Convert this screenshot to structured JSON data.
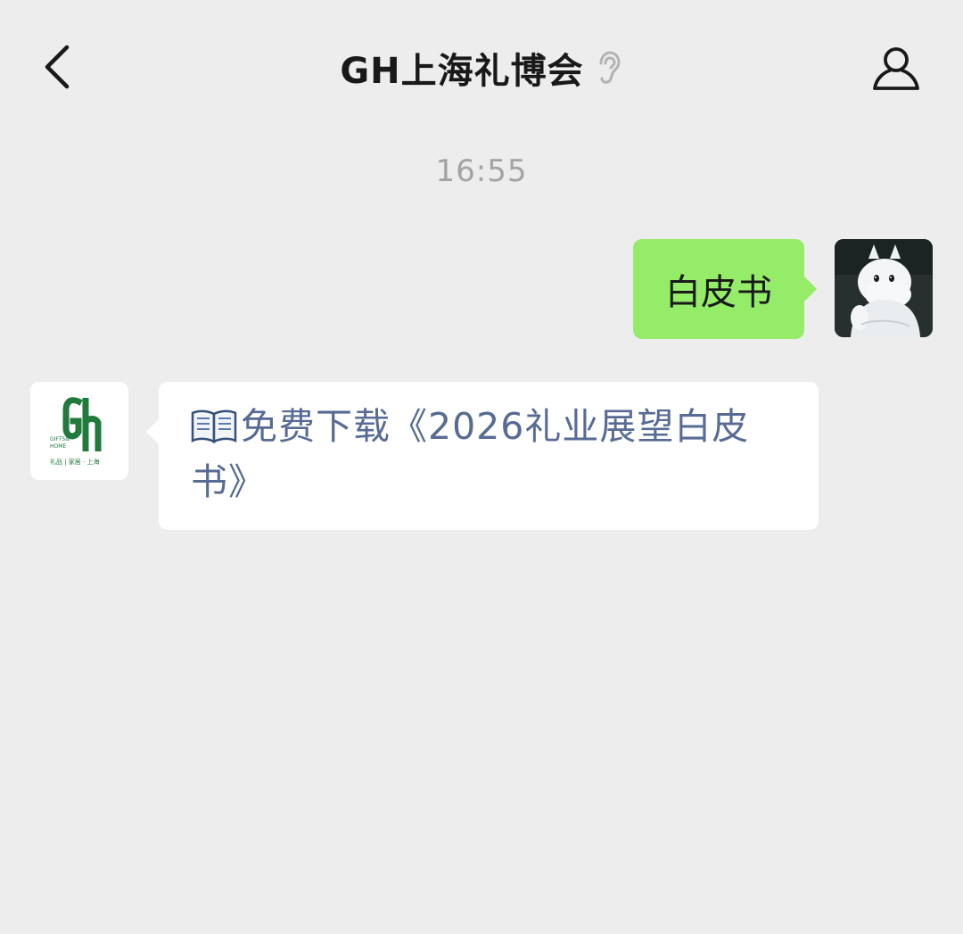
{
  "header": {
    "title": "GH上海礼博会",
    "back_icon": "chevron-left-icon",
    "muted_icon": "ear-icon",
    "profile_icon": "person-icon"
  },
  "chat": {
    "timestamp": "16:55",
    "messages": [
      {
        "direction": "outgoing",
        "text": "白皮书",
        "bubble_color": "#95ec69"
      },
      {
        "direction": "incoming",
        "emoji": "📖",
        "text": "免费下载《2026礼业展望白皮书》",
        "link_color": "#576b95"
      }
    ]
  },
  "avatars": {
    "gh_logo": {
      "letters": "GH",
      "tagline": "GIFTS & HOME",
      "subtitle": "礼品 | 家居 · 上海",
      "brand_color": "#1f7a3c"
    }
  }
}
